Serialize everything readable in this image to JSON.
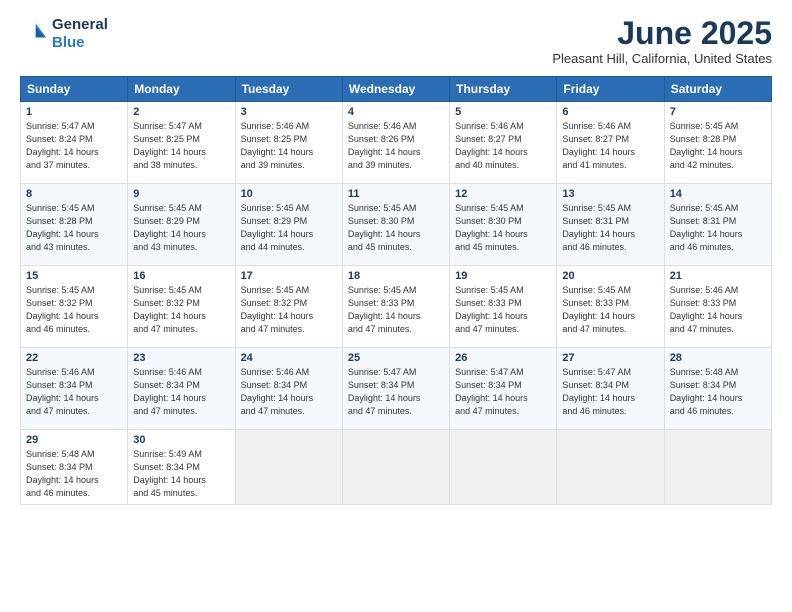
{
  "header": {
    "logo_line1": "General",
    "logo_line2": "Blue",
    "month": "June 2025",
    "location": "Pleasant Hill, California, United States"
  },
  "days_of_week": [
    "Sunday",
    "Monday",
    "Tuesday",
    "Wednesday",
    "Thursday",
    "Friday",
    "Saturday"
  ],
  "weeks": [
    [
      {
        "day": "1",
        "sunrise": "5:47 AM",
        "sunset": "8:24 PM",
        "daylight": "14 hours and 37 minutes."
      },
      {
        "day": "2",
        "sunrise": "5:47 AM",
        "sunset": "8:25 PM",
        "daylight": "14 hours and 38 minutes."
      },
      {
        "day": "3",
        "sunrise": "5:46 AM",
        "sunset": "8:25 PM",
        "daylight": "14 hours and 39 minutes."
      },
      {
        "day": "4",
        "sunrise": "5:46 AM",
        "sunset": "8:26 PM",
        "daylight": "14 hours and 39 minutes."
      },
      {
        "day": "5",
        "sunrise": "5:46 AM",
        "sunset": "8:27 PM",
        "daylight": "14 hours and 40 minutes."
      },
      {
        "day": "6",
        "sunrise": "5:46 AM",
        "sunset": "8:27 PM",
        "daylight": "14 hours and 41 minutes."
      },
      {
        "day": "7",
        "sunrise": "5:45 AM",
        "sunset": "8:28 PM",
        "daylight": "14 hours and 42 minutes."
      }
    ],
    [
      {
        "day": "8",
        "sunrise": "5:45 AM",
        "sunset": "8:28 PM",
        "daylight": "14 hours and 43 minutes."
      },
      {
        "day": "9",
        "sunrise": "5:45 AM",
        "sunset": "8:29 PM",
        "daylight": "14 hours and 43 minutes."
      },
      {
        "day": "10",
        "sunrise": "5:45 AM",
        "sunset": "8:29 PM",
        "daylight": "14 hours and 44 minutes."
      },
      {
        "day": "11",
        "sunrise": "5:45 AM",
        "sunset": "8:30 PM",
        "daylight": "14 hours and 45 minutes."
      },
      {
        "day": "12",
        "sunrise": "5:45 AM",
        "sunset": "8:30 PM",
        "daylight": "14 hours and 45 minutes."
      },
      {
        "day": "13",
        "sunrise": "5:45 AM",
        "sunset": "8:31 PM",
        "daylight": "14 hours and 46 minutes."
      },
      {
        "day": "14",
        "sunrise": "5:45 AM",
        "sunset": "8:31 PM",
        "daylight": "14 hours and 46 minutes."
      }
    ],
    [
      {
        "day": "15",
        "sunrise": "5:45 AM",
        "sunset": "8:32 PM",
        "daylight": "14 hours and 46 minutes."
      },
      {
        "day": "16",
        "sunrise": "5:45 AM",
        "sunset": "8:32 PM",
        "daylight": "14 hours and 47 minutes."
      },
      {
        "day": "17",
        "sunrise": "5:45 AM",
        "sunset": "8:32 PM",
        "daylight": "14 hours and 47 minutes."
      },
      {
        "day": "18",
        "sunrise": "5:45 AM",
        "sunset": "8:33 PM",
        "daylight": "14 hours and 47 minutes."
      },
      {
        "day": "19",
        "sunrise": "5:45 AM",
        "sunset": "8:33 PM",
        "daylight": "14 hours and 47 minutes."
      },
      {
        "day": "20",
        "sunrise": "5:45 AM",
        "sunset": "8:33 PM",
        "daylight": "14 hours and 47 minutes."
      },
      {
        "day": "21",
        "sunrise": "5:46 AM",
        "sunset": "8:33 PM",
        "daylight": "14 hours and 47 minutes."
      }
    ],
    [
      {
        "day": "22",
        "sunrise": "5:46 AM",
        "sunset": "8:34 PM",
        "daylight": "14 hours and 47 minutes."
      },
      {
        "day": "23",
        "sunrise": "5:46 AM",
        "sunset": "8:34 PM",
        "daylight": "14 hours and 47 minutes."
      },
      {
        "day": "24",
        "sunrise": "5:46 AM",
        "sunset": "8:34 PM",
        "daylight": "14 hours and 47 minutes."
      },
      {
        "day": "25",
        "sunrise": "5:47 AM",
        "sunset": "8:34 PM",
        "daylight": "14 hours and 47 minutes."
      },
      {
        "day": "26",
        "sunrise": "5:47 AM",
        "sunset": "8:34 PM",
        "daylight": "14 hours and 47 minutes."
      },
      {
        "day": "27",
        "sunrise": "5:47 AM",
        "sunset": "8:34 PM",
        "daylight": "14 hours and 46 minutes."
      },
      {
        "day": "28",
        "sunrise": "5:48 AM",
        "sunset": "8:34 PM",
        "daylight": "14 hours and 46 minutes."
      }
    ],
    [
      {
        "day": "29",
        "sunrise": "5:48 AM",
        "sunset": "8:34 PM",
        "daylight": "14 hours and 46 minutes."
      },
      {
        "day": "30",
        "sunrise": "5:49 AM",
        "sunset": "8:34 PM",
        "daylight": "14 hours and 45 minutes."
      },
      null,
      null,
      null,
      null,
      null
    ]
  ]
}
